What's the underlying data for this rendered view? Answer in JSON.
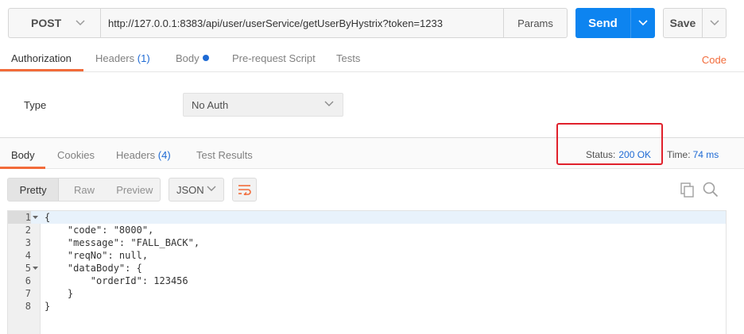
{
  "request": {
    "method": "POST",
    "url": "http://127.0.0.1:8383/api/user/userService/getUserByHystrix?token=1233",
    "params_label": "Params",
    "send_label": "Send",
    "save_label": "Save"
  },
  "request_tabs": {
    "authorization": "Authorization",
    "headers": "Headers",
    "headers_count": "(1)",
    "body": "Body",
    "prerequest": "Pre-request Script",
    "tests": "Tests",
    "code": "Code"
  },
  "auth": {
    "type_label": "Type",
    "type_value": "No Auth"
  },
  "response_tabs": {
    "body": "Body",
    "cookies": "Cookies",
    "headers": "Headers",
    "headers_count": "(4)",
    "test_results": "Test Results"
  },
  "response_meta": {
    "status_label": "Status:",
    "status_value": "200 OK",
    "time_label": "Time:",
    "time_value": "74 ms"
  },
  "body_toolbar": {
    "views": [
      "Pretty",
      "Raw",
      "Preview"
    ],
    "format": "JSON"
  },
  "response_body": {
    "lines": [
      {
        "n": "1",
        "text": "{"
      },
      {
        "n": "2",
        "text": "    \"code\": \"8000\","
      },
      {
        "n": "3",
        "text": "    \"message\": \"FALL_BACK\","
      },
      {
        "n": "4",
        "text": "    \"reqNo\": null,"
      },
      {
        "n": "5",
        "text": "    \"dataBody\": {"
      },
      {
        "n": "6",
        "text": "        \"orderId\": 123456"
      },
      {
        "n": "7",
        "text": "    }"
      },
      {
        "n": "8",
        "text": "}"
      }
    ]
  },
  "colors": {
    "accent": "#f26b3a",
    "send": "#0d84f0",
    "link": "#1e6ad4",
    "highlight": "#e0212c"
  }
}
